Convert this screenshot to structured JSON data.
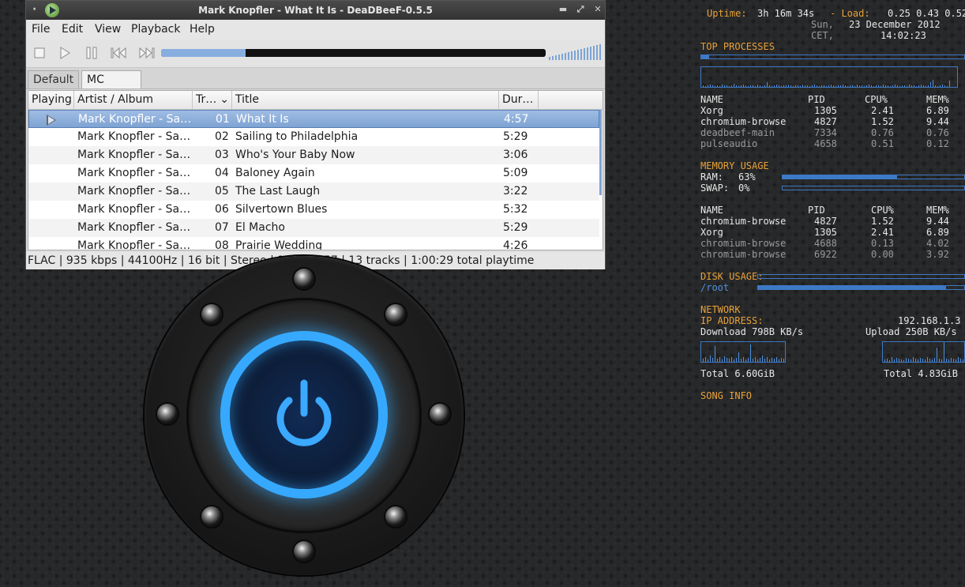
{
  "window": {
    "title": "Mark Knopfler - What It Is - DeaDBeeF-0.5.5",
    "menu": [
      "File",
      "Edit",
      "View",
      "Playback",
      "Help"
    ],
    "seek_progress": 0.22,
    "volume_level": 1.0,
    "tabs": [
      "Default",
      "MC"
    ],
    "active_tab": "MC",
    "columns": [
      "Playing",
      "Artist / Album",
      "Tr…",
      "Title",
      "Dur…"
    ],
    "tracks": [
      {
        "artist": "Mark Knopfler - Sa…",
        "track": "01",
        "title": "What It Is",
        "duration": "4:57"
      },
      {
        "artist": "Mark Knopfler - Sa…",
        "track": "02",
        "title": "Sailing to Philadelphia",
        "duration": "5:29"
      },
      {
        "artist": "Mark Knopfler - Sa…",
        "track": "03",
        "title": "Who's Your Baby Now",
        "duration": "3:06"
      },
      {
        "artist": "Mark Knopfler - Sa…",
        "track": "04",
        "title": "Baloney Again",
        "duration": "5:09"
      },
      {
        "artist": "Mark Knopfler - Sa…",
        "track": "05",
        "title": "The Last Laugh",
        "duration": "3:22"
      },
      {
        "artist": "Mark Knopfler - Sa…",
        "track": "06",
        "title": "Silvertown Blues",
        "duration": "5:32"
      },
      {
        "artist": "Mark Knopfler - Sa…",
        "track": "07",
        "title": "El Macho",
        "duration": "5:29"
      },
      {
        "artist": "Mark Knopfler - Sa…",
        "track": "08",
        "title": "Prairie Wedding",
        "duration": "4:26"
      }
    ],
    "status": "FLAC | 935 kbps | 44100Hz | 16 bit | Stereo | 1:03 / 4:57 | 13 tracks | 1:00:29 total playtime"
  },
  "conky": {
    "uptime_label": "Uptime:",
    "uptime": "3h 16m 34s",
    "load_label": "- Load:",
    "load": "0.25 0.43 0.52",
    "day": "Sun,",
    "date": "23 December 2012",
    "tz": "CET,",
    "time": "14:02:23",
    "top_processes_label": "TOP PROCESSES",
    "cpu_usage": 0.03,
    "proc_headers": [
      "NAME",
      "PID",
      "CPU%",
      "MEM%"
    ],
    "cpu_procs": [
      {
        "name": "Xorg",
        "pid": "1305",
        "cpu": "2.41",
        "mem": "6.89"
      },
      {
        "name": "chromium-browse",
        "pid": "4827",
        "cpu": "1.52",
        "mem": "9.44"
      },
      {
        "name": "deadbeef-main",
        "pid": "7334",
        "cpu": "0.76",
        "mem": "0.76"
      },
      {
        "name": "pulseaudio",
        "pid": "4658",
        "cpu": "0.51",
        "mem": "0.12"
      }
    ],
    "memory_label": "MEMORY USAGE",
    "ram_label": "RAM:",
    "ram": "63%",
    "ram_value": 0.63,
    "swap_label": "SWAP:",
    "swap": "0%",
    "swap_value": 0,
    "mem_procs": [
      {
        "name": "chromium-browse",
        "pid": "4827",
        "cpu": "1.52",
        "mem": "9.44"
      },
      {
        "name": "Xorg",
        "pid": "1305",
        "cpu": "2.41",
        "mem": "6.89"
      },
      {
        "name": "chromium-browse",
        "pid": "4688",
        "cpu": "0.13",
        "mem": "4.02"
      },
      {
        "name": "chromium-browse",
        "pid": "6922",
        "cpu": "0.00",
        "mem": "3.92"
      }
    ],
    "disk_label": "DISK USAGE:",
    "disk_mount": "/root",
    "disk_value": 0.91,
    "network_label": "NETWORK",
    "ip_label": "IP ADDRESS:",
    "ip": "192.168.1.3",
    "download": "Download 798B KB/s",
    "upload": "Upload 250B KB/s",
    "total_down": "Total 6.60GiB",
    "total_up": "Total 4.83GiB",
    "song_info_label": "SONG INFO"
  },
  "colors": {
    "accent": "#4f8fe0",
    "label": "#e8a13a",
    "selection": "#7fa3d2",
    "power_glow": "#36a9ff"
  }
}
